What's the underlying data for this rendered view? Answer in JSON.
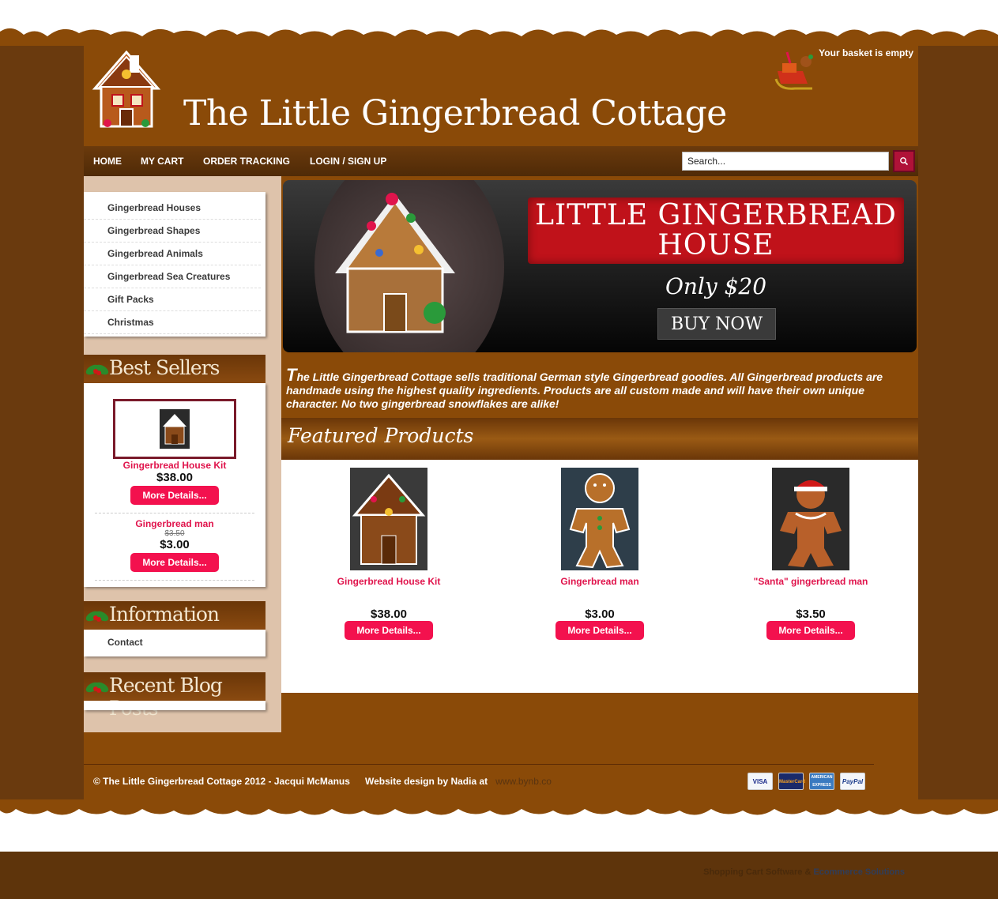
{
  "site": {
    "title": "The Little Gingerbread Cottage",
    "basket_text": "Your basket is empty"
  },
  "nav": {
    "items": [
      "HOME",
      "MY CART",
      "ORDER TRACKING",
      "LOGIN / SIGN UP"
    ],
    "search_value": "Search..."
  },
  "categories": [
    "Gingerbread Houses",
    "Gingerbread Shapes",
    "Gingerbread Animals",
    "Gingerbread Sea Creatures",
    "Gift Packs",
    "Christmas"
  ],
  "best_sellers": {
    "title": "Best Sellers",
    "items": [
      {
        "name": "Gingerbread House Kit",
        "price": "$38.00",
        "button": "More Details..."
      },
      {
        "name": "Gingerbread man",
        "old_price": "$3.50",
        "price": "$3.00",
        "button": "More Details..."
      }
    ]
  },
  "information": {
    "title": "Information",
    "links": [
      "Contact"
    ]
  },
  "blog": {
    "title": "Recent Blog Posts"
  },
  "banner": {
    "line1": "LITTLE GINGERBREAD",
    "line2": "HOUSE",
    "price": "Only $20",
    "button": "BUY NOW"
  },
  "intro": {
    "first_letter": "T",
    "text": "he Little Gingerbread Cottage sells traditional German style Gingerbread goodies. All Gingerbread products are handmade using the highest quality ingredients. Products are all custom made and will have their own unique character. No two gingerbread snowflakes are alike!"
  },
  "featured": {
    "title": "Featured Products",
    "products": [
      {
        "name": "Gingerbread House Kit",
        "price": "$38.00",
        "button": "More Details..."
      },
      {
        "name": "Gingerbread man",
        "price": "$3.00",
        "button": "More Details..."
      },
      {
        "name": "\"Santa\" gingerbread man",
        "price": "$3.50",
        "button": "More Details..."
      }
    ]
  },
  "footer": {
    "copyright": "© The Little Gingerbread Cottage 2012 - Jacqui McManus",
    "design_label": "Website design by Nadia at",
    "design_link": "www.bynb.co",
    "cards": [
      "VISA",
      "MasterCard",
      "AMERICAN EXPRESS",
      "PayPal"
    ],
    "powered_prefix": "Shopping Cart Software &",
    "powered_link": "Ecommerce Solutions"
  },
  "colors": {
    "page_brown": "#8a4a08",
    "outer_brown": "#6a3a0e",
    "accent_pink": "#f3114e",
    "link_red": "#e0144c",
    "sidebar_bg": "#dec3ab"
  }
}
